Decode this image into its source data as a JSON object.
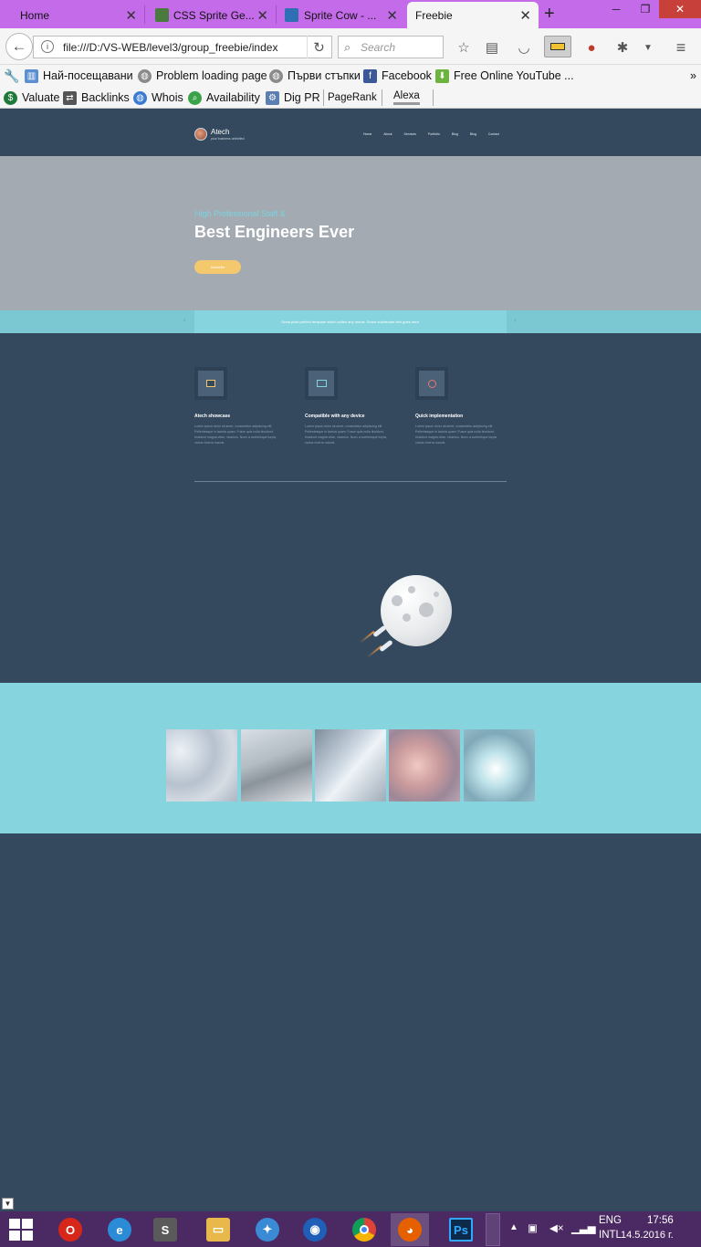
{
  "browser": {
    "tabs": [
      {
        "title": "Home"
      },
      {
        "title": "CSS Sprite Ge..."
      },
      {
        "title": "Sprite Cow - ..."
      },
      {
        "title": "Freebie"
      }
    ],
    "new_tab": "+",
    "url": "file:///D:/VS-WEB/level3/group_freebie/index",
    "search_placeholder": "Search",
    "bookmarks_row1": [
      "Най-посещавани",
      "Problem loading page",
      "Първи стъпки",
      "Facebook",
      "Free Online YouTube ..."
    ],
    "bookmarks_row2": [
      "Valuate",
      "Backlinks",
      "Whois",
      "Availability",
      "Dig PR",
      "PageRank",
      "Alexa"
    ],
    "overflow": "»"
  },
  "site": {
    "logo_name": "Atech",
    "logo_tagline": "your business unlimited",
    "menu": [
      "Home",
      "About",
      "Services",
      "Portfolio",
      "Blog",
      "Blog",
      "Contact"
    ],
    "hero_subtitle": "High Professional Staff &",
    "hero_title": "Best Engineers Ever",
    "hero_button": "Subscribe",
    "strip_text": "Great pixel perfect template which suites any needs. Some subheader text goes here.",
    "strip_prev": "‹",
    "strip_next": "›",
    "features": [
      {
        "title": "Atech showcase",
        "text": "Lorem ipsum dolor sit amet, consectetur adipiscing elit. Pellentesque in lacinia quam. Fusce quis nulla tincidunt, tincidunt magna vitae, vivamus. Nunc a scelerisque turpis, varius viverra mauris.",
        "icon": "image-icon"
      },
      {
        "title": "Compatible with any device",
        "text": "Lorem ipsum dolor sit amet, consectetur adipiscing elit. Pellentesque in lacinia quam. Fusce quis nulla tincidunt, tincidunt magna vitae, vivamus. Nunc a scelerisque turpis, varius viverra mauris.",
        "icon": "monitor-icon"
      },
      {
        "title": "Quick implementation",
        "text": "Lorem ipsum dolor sit amet, consectetur adipiscing elit. Pellentesque in lacinia quam. Fusce quis nulla tincidunt, tincidunt magna vitae, vivamus. Nunc a scelerisque turpis, varius viverra mauris.",
        "icon": "target-icon"
      }
    ]
  },
  "taskbar": {
    "lang": "ENG",
    "layout": "INTL",
    "time": "17:56",
    "date": "14.5.2016 г."
  },
  "colors": {
    "page_bg": "#34495e",
    "hero_bg": "#a3aab2",
    "accent_cyan": "#86d5de",
    "button_yellow": "#f4c96e",
    "tabbar_purple": "#c36be9",
    "taskbar_purple": "#4b2a63"
  }
}
